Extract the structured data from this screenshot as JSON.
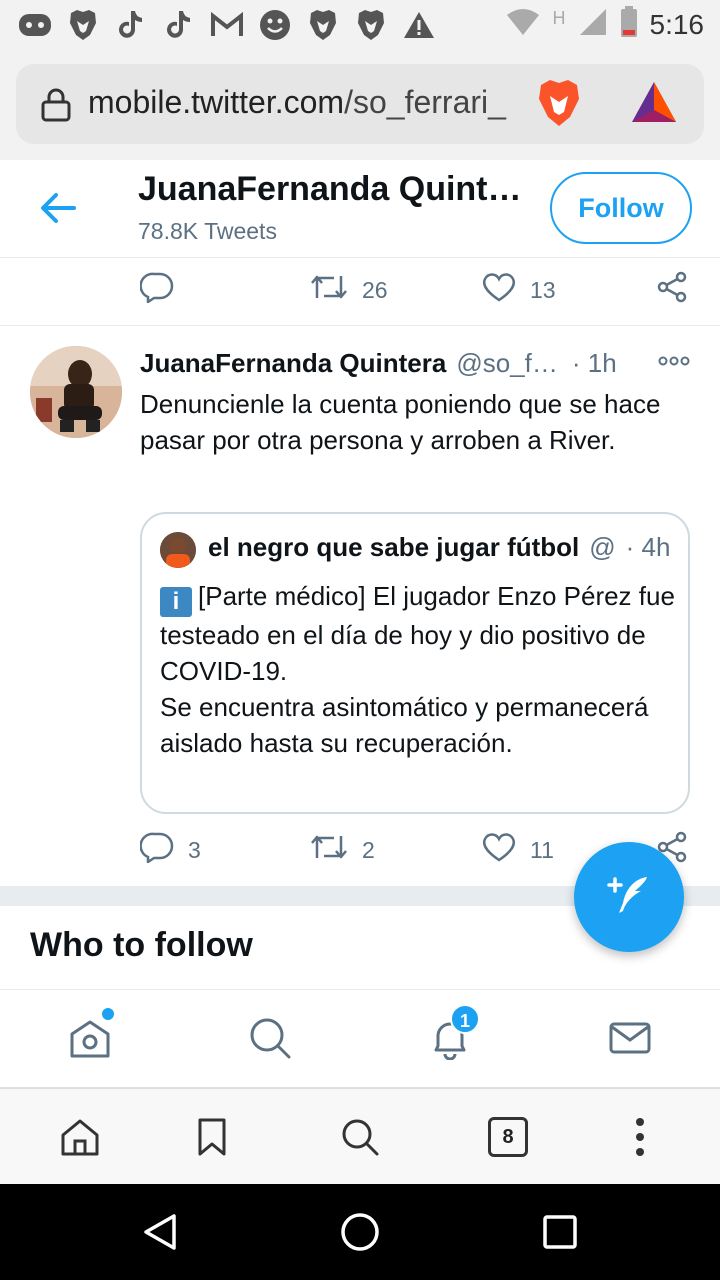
{
  "status_bar": {
    "time": "5:16",
    "notification_icons": [
      "discord-icon",
      "brave-icon",
      "tiktok-icon",
      "tiktok-icon",
      "gmail-icon",
      "emoji-icon",
      "brave-icon",
      "brave-icon",
      "warning-icon"
    ],
    "network_type": "H"
  },
  "browser": {
    "url_host": "mobile.twitter.com",
    "url_path": "/so_ferrari_",
    "tabs_count": "8"
  },
  "header": {
    "name": "JuanaFernanda Quint…",
    "tweet_count": "78.8K Tweets",
    "follow_label": "Follow"
  },
  "prev_tweet_actions": {
    "replies": "",
    "retweets": "26",
    "likes": "13"
  },
  "tweet": {
    "name": "JuanaFernanda Quintera",
    "handle": "@so_f…",
    "time": "· 1h",
    "text": "Denuncienle la cuenta poniendo que se hace pasar por otra persona y arroben a River.",
    "quote": {
      "name": "el negro que sabe jugar fútbol",
      "handle": "@",
      "time": "· 4h",
      "badge": "i",
      "text_line1": "[Parte médico] El jugador Enzo Pérez fue testeado en el día de hoy y dio positivo de COVID-19.",
      "text_line2": "Se encuentra asintomático y permanecerá aislado hasta su recuperación."
    },
    "actions": {
      "replies": "3",
      "retweets": "2",
      "likes": "11"
    }
  },
  "who_to_follow": {
    "title": "Who to follow"
  },
  "twitter_nav": {
    "notifications_badge": "1"
  },
  "colors": {
    "accent": "#1da1f2",
    "text": "#0f1419",
    "secondary": "#5b7083"
  }
}
